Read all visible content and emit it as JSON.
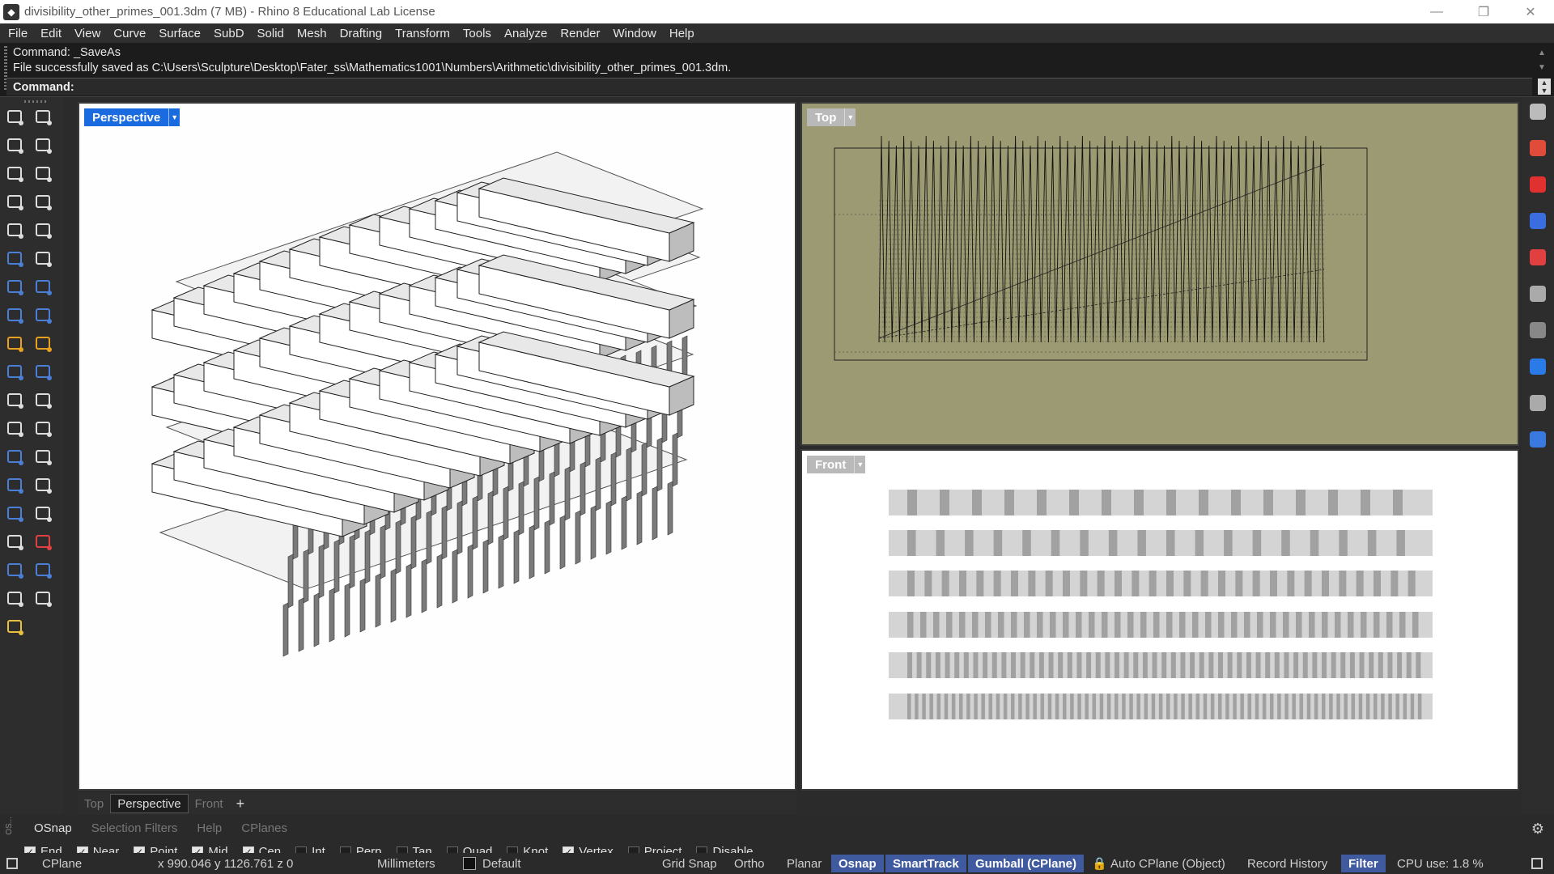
{
  "window": {
    "title": "divisibility_other_primes_001.3dm (7 MB) - Rhino 8 Educational Lab License",
    "minimize_glyph": "—",
    "maximize_glyph": "❐",
    "close_glyph": "✕"
  },
  "menu": [
    "File",
    "Edit",
    "View",
    "Curve",
    "Surface",
    "SubD",
    "Solid",
    "Mesh",
    "Drafting",
    "Transform",
    "Tools",
    "Analyze",
    "Render",
    "Window",
    "Help"
  ],
  "command": {
    "history_line1": "Command: _SaveAs",
    "history_line2": "File successfully saved as C:\\Users\\Sculpture\\Desktop\\Fater_ss\\Mathematics1001\\Numbers\\Arithmetic\\divisibility_other_primes_001.3dm.",
    "prompt_label": "Command:"
  },
  "viewports": {
    "perspective": {
      "name": "Perspective"
    },
    "top": {
      "name": "Top"
    },
    "front": {
      "name": "Front"
    }
  },
  "viewport_tabs": [
    "Top",
    "Perspective",
    "Front"
  ],
  "viewport_tabs_active": "Perspective",
  "viewport_add_glyph": "+",
  "panel_tabs": [
    "OSnap",
    "Selection Filters",
    "Help",
    "CPlanes"
  ],
  "panel_side_label": "OS...",
  "osnap": [
    {
      "label": "End",
      "checked": true
    },
    {
      "label": "Near",
      "checked": true
    },
    {
      "label": "Point",
      "checked": true
    },
    {
      "label": "Mid",
      "checked": true
    },
    {
      "label": "Cen",
      "checked": true
    },
    {
      "label": "Int",
      "checked": false
    },
    {
      "label": "Perp",
      "checked": false
    },
    {
      "label": "Tan",
      "checked": false
    },
    {
      "label": "Quad",
      "checked": false
    },
    {
      "label": "Knot",
      "checked": false
    },
    {
      "label": "Vertex",
      "checked": true
    },
    {
      "label": "Project",
      "checked": false
    },
    {
      "label": "Disable",
      "checked": false
    }
  ],
  "status": {
    "cplane": "CPlane",
    "coords": "x 990.046   y 1126.761   z 0",
    "units": "Millimeters",
    "layer": "Default",
    "grid_snap": "Grid Snap",
    "ortho": "Ortho",
    "planar": "Planar",
    "osnap": "Osnap",
    "smarttrack": "SmartTrack",
    "gumball": "Gumball (CPlane)",
    "auto_cplane": "Auto CPlane (Object)",
    "record_history": "Record History",
    "filter": "Filter",
    "cpu": "CPU use: 1.8 %"
  },
  "colors": {
    "accent": "#1a6ae0",
    "top_viewport_bg": "#9c9a72",
    "status_active": "#3f5a9e"
  }
}
